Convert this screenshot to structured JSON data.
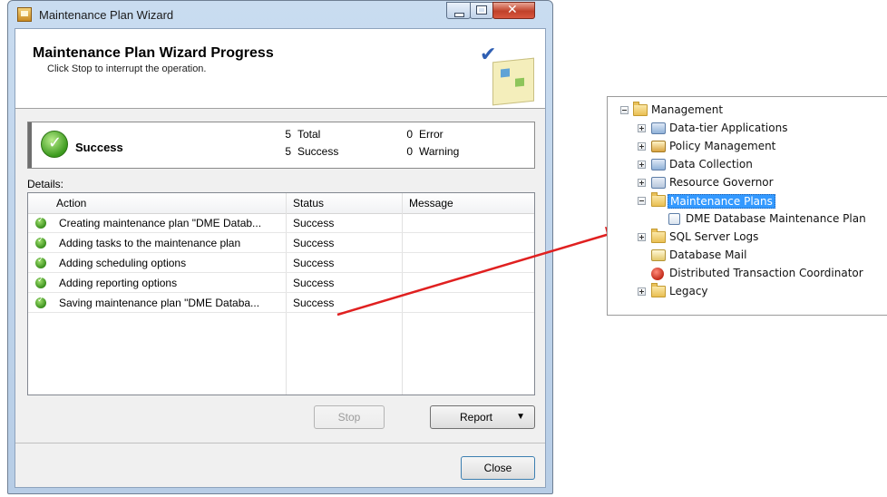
{
  "window": {
    "title": "Maintenance Plan Wizard",
    "header_title": "Maintenance Plan Wizard Progress",
    "header_subtitle": "Click Stop to interrupt the operation."
  },
  "summary": {
    "status": "Success",
    "total_count": "5",
    "total_label": "Total",
    "success_count": "5",
    "success_label": "Success",
    "error_count": "0",
    "error_label": "Error",
    "warning_count": "0",
    "warning_label": "Warning"
  },
  "details": {
    "label": "Details:",
    "columns": [
      "Action",
      "Status",
      "Message"
    ],
    "rows": [
      {
        "action": "Creating maintenance plan \"DME Datab...",
        "status": "Success",
        "message": ""
      },
      {
        "action": "Adding tasks to the maintenance plan",
        "status": "Success",
        "message": ""
      },
      {
        "action": "Adding scheduling options",
        "status": "Success",
        "message": ""
      },
      {
        "action": "Adding reporting options",
        "status": "Success",
        "message": ""
      },
      {
        "action": "Saving maintenance plan \"DME Databa...",
        "status": "Success",
        "message": ""
      }
    ]
  },
  "buttons": {
    "stop": "Stop",
    "report": "Report",
    "close": "Close"
  },
  "tree": {
    "items": [
      {
        "label": "Management",
        "icon": "folder-icon",
        "expander": "minus"
      },
      {
        "label": "Data-tier Applications",
        "icon": "data-tier-icon",
        "expander": "plus"
      },
      {
        "label": "Policy Management",
        "icon": "policy-icon",
        "expander": "plus"
      },
      {
        "label": "Data Collection",
        "icon": "data-collection-icon",
        "expander": "plus"
      },
      {
        "label": "Resource Governor",
        "icon": "resource-governor-icon",
        "expander": "plus"
      },
      {
        "label": "Maintenance Plans",
        "icon": "folder-icon",
        "expander": "minus",
        "selected": true
      },
      {
        "label": "DME Database Maintenance Plan",
        "icon": "maintenance-plan-icon",
        "expander": "none"
      },
      {
        "label": "SQL Server Logs",
        "icon": "folder-icon",
        "expander": "plus"
      },
      {
        "label": "Database Mail",
        "icon": "database-mail-icon",
        "expander": "none"
      },
      {
        "label": "Distributed Transaction Coordinator",
        "icon": "dtc-icon",
        "expander": "none"
      },
      {
        "label": "Legacy",
        "icon": "folder-icon",
        "expander": "plus"
      }
    ]
  },
  "colors": {
    "selection": "#3399ff",
    "arrow": "#e02020",
    "success_green": "#3c9a1e"
  }
}
